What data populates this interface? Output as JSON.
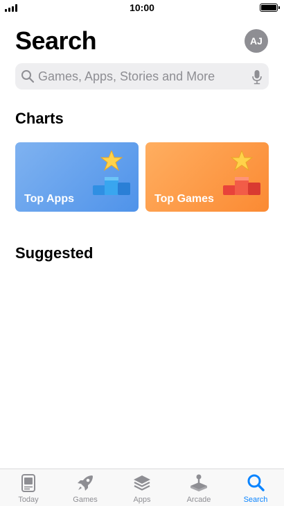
{
  "status_bar": {
    "time": "10:00"
  },
  "header": {
    "title": "Search",
    "avatar_initials": "AJ"
  },
  "search": {
    "placeholder": "Games, Apps, Stories and More"
  },
  "charts": {
    "title": "Charts",
    "cards": [
      {
        "label": "Top Apps",
        "color": "#5e9ced",
        "icon": "podium-star-icon"
      },
      {
        "label": "Top Games",
        "color": "#fd973f",
        "icon": "podium-star-icon"
      }
    ]
  },
  "suggested": {
    "title": "Suggested"
  },
  "tab_bar": {
    "accent": "#0a84ff",
    "items": [
      {
        "label": "Today",
        "icon": "today-icon",
        "active": false
      },
      {
        "label": "Games",
        "icon": "rocket-icon",
        "active": false
      },
      {
        "label": "Apps",
        "icon": "stack-icon",
        "active": false
      },
      {
        "label": "Arcade",
        "icon": "joystick-icon",
        "active": false
      },
      {
        "label": "Search",
        "icon": "search-icon",
        "active": true
      }
    ]
  }
}
